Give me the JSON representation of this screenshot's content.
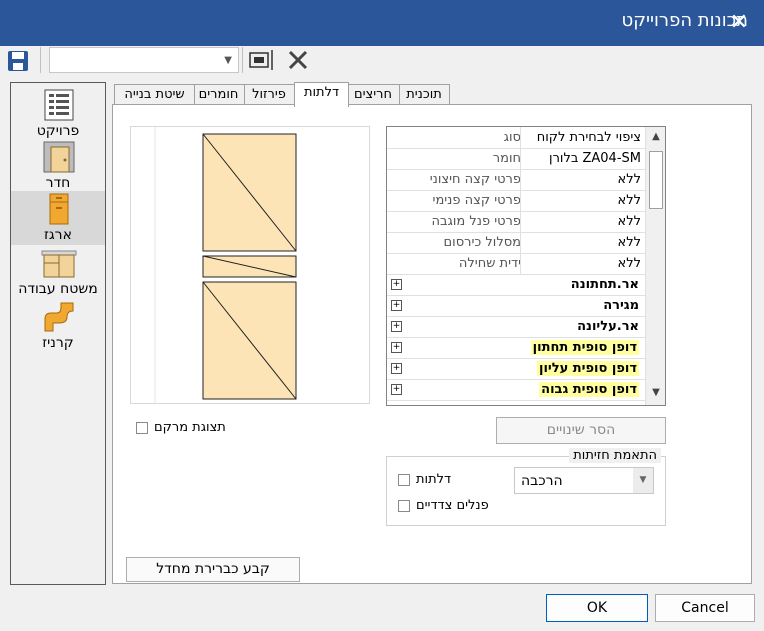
{
  "window": {
    "title": "תכונות הפרוייקט"
  },
  "toolbar": {
    "combo_value": ""
  },
  "sidebar": {
    "items": [
      {
        "label": "פרויקט",
        "icon": "project-sheet-icon"
      },
      {
        "label": "חדר",
        "icon": "room-icon"
      },
      {
        "label": "ארגז",
        "icon": "cabinet-icon"
      },
      {
        "label": "משטח עבודה",
        "icon": "countertop-icon"
      },
      {
        "label": "קרניז",
        "icon": "cornice-icon"
      }
    ],
    "selected": "ארגז"
  },
  "tabs": [
    {
      "label": "תוכנית"
    },
    {
      "label": "חריצים"
    },
    {
      "label": "דלתות"
    },
    {
      "label": "פירזול"
    },
    {
      "label": "חומרים"
    },
    {
      "label": "שיטת בנייה"
    }
  ],
  "active_tab": "דלתות",
  "properties": {
    "rows": [
      {
        "name": "סוג",
        "value": "ציפוי לבחירת לקוח"
      },
      {
        "name": "חומר",
        "value": "בלורן ZA04-SM"
      },
      {
        "name": "פרטי קצה חיצוני",
        "value": "ללא"
      },
      {
        "name": "פרטי קצה פנימי",
        "value": "ללא"
      },
      {
        "name": "פרטי פנל מוגבה",
        "value": "ללא"
      },
      {
        "name": "מסלול כירסום",
        "value": "ללא"
      },
      {
        "name": "ידית שחילה",
        "value": "ללא"
      }
    ],
    "groups": [
      {
        "label": "אר.תחתונה",
        "highlight": false
      },
      {
        "label": "מגירה",
        "highlight": false
      },
      {
        "label": "אר.עליונה",
        "highlight": false
      },
      {
        "label": "דופן סופית תחתון",
        "highlight": true
      },
      {
        "label": "דופן סופית עליון",
        "highlight": true
      },
      {
        "label": "דופן סופית גבוה",
        "highlight": true
      }
    ]
  },
  "focus_view": {
    "label": "תצוגת מרקם",
    "checked": false
  },
  "revert_button": "הסר שינויים",
  "match_group": {
    "title": "התאמת חזיתות",
    "doors": {
      "label": "דלתות",
      "checked": false
    },
    "side_panels": {
      "label": "פנלים צדדיים",
      "checked": false
    },
    "select_value": "הרכבה"
  },
  "set_default_button": "קבע כברירת מחדל",
  "ok_button": "OK",
  "cancel_button": "Cancel",
  "colors": {
    "titlebar": "#2b579a",
    "door_fill": "#fde4b7",
    "highlight": "#ffffa0"
  }
}
